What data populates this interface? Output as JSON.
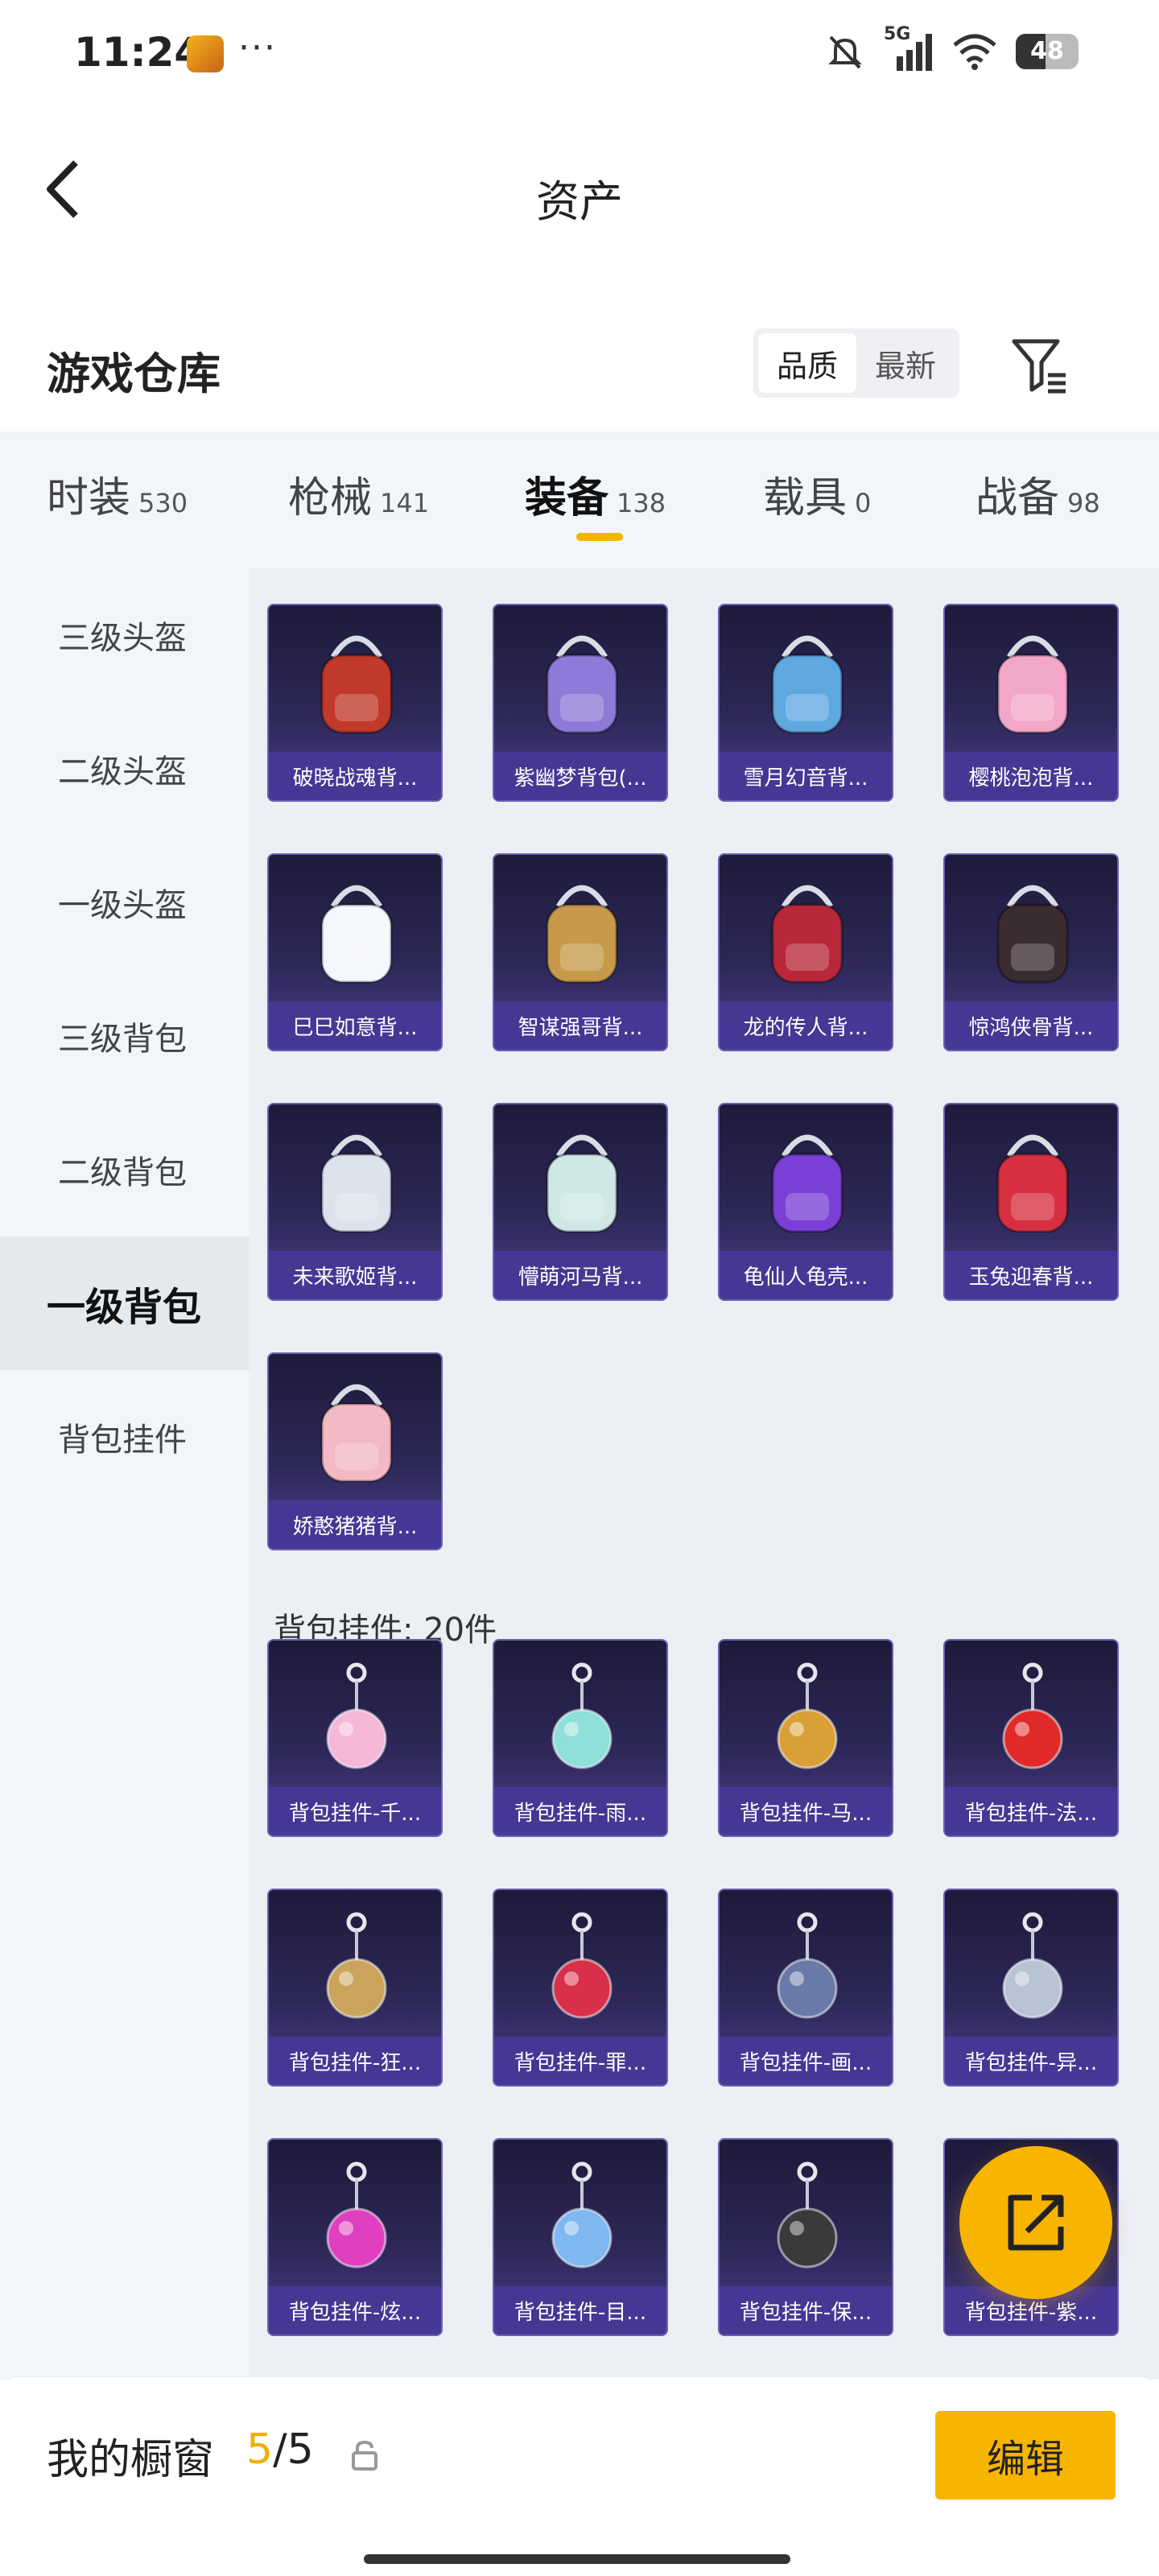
{
  "status_bar": {
    "time": "11:24",
    "more": "···",
    "network": "5G",
    "battery": "48"
  },
  "header": {
    "title": "资产"
  },
  "warehouse": {
    "title": "游戏仓库",
    "sort_options": [
      "品质",
      "最新"
    ],
    "active_sort": "品质"
  },
  "tabs": [
    {
      "label": "时装",
      "count": "530"
    },
    {
      "label": "枪械",
      "count": "141"
    },
    {
      "label": "装备",
      "count": "138"
    },
    {
      "label": "载具",
      "count": "0"
    },
    {
      "label": "战备",
      "count": "98"
    }
  ],
  "active_tab": "装备",
  "sidebar": [
    "三级头盔",
    "二级头盔",
    "一级头盔",
    "三级背包",
    "二级背包",
    "一级背包",
    "背包挂件"
  ],
  "active_sidebar": "一级背包",
  "backpacks": [
    {
      "label": "破晓战魂背...",
      "color": "#c0392b"
    },
    {
      "label": "紫幽梦背包(...",
      "color": "#8e7ad8"
    },
    {
      "label": "雪月幻音背...",
      "color": "#5fa8e0"
    },
    {
      "label": "樱桃泡泡背...",
      "color": "#f2a7c8"
    },
    {
      "label": "巳巳如意背...",
      "color": "#f4f7fb"
    },
    {
      "label": "智谋强哥背...",
      "color": "#c69a4a"
    },
    {
      "label": "龙的传人背...",
      "color": "#b8283a"
    },
    {
      "label": "惊鸿侠骨背...",
      "color": "#3a2c30"
    },
    {
      "label": "未来歌姬背...",
      "color": "#dce3ec"
    },
    {
      "label": "懵萌河马背...",
      "color": "#cfe8e6"
    },
    {
      "label": "龟仙人龟壳...",
      "color": "#7a3fd6"
    },
    {
      "label": "玉兔迎春背...",
      "color": "#d63040"
    },
    {
      "label": "娇憨猪猪背...",
      "color": "#f3b9c4"
    }
  ],
  "charms_section": {
    "title": "背包挂件: 20件"
  },
  "charms": [
    {
      "label": "背包挂件-千...",
      "color": "#f5b8d8"
    },
    {
      "label": "背包挂件-雨...",
      "color": "#8fe0d8"
    },
    {
      "label": "背包挂件-马...",
      "color": "#d9a038"
    },
    {
      "label": "背包挂件-法...",
      "color": "#e02a2a"
    },
    {
      "label": "背包挂件-狂...",
      "color": "#c9a45a"
    },
    {
      "label": "背包挂件-罪...",
      "color": "#d8304a"
    },
    {
      "label": "背包挂件-画...",
      "color": "#6a7aa8"
    },
    {
      "label": "背包挂件-异...",
      "color": "#b8c4d4"
    },
    {
      "label": "背包挂件-炫...",
      "color": "#e040c0"
    },
    {
      "label": "背包挂件-目...",
      "color": "#7fb8f0"
    },
    {
      "label": "背包挂件-保...",
      "color": "#3a3a3a"
    },
    {
      "label": "背包挂件-紫...",
      "color": "#9a7ad8"
    }
  ],
  "showcase": {
    "label": "我的橱窗",
    "current": "5",
    "separator": "/",
    "max": "5",
    "edit_label": "编辑"
  },
  "colors": {
    "accent": "#f8b500",
    "card_bg": "#2c2756",
    "card_label": "#4637a0"
  }
}
